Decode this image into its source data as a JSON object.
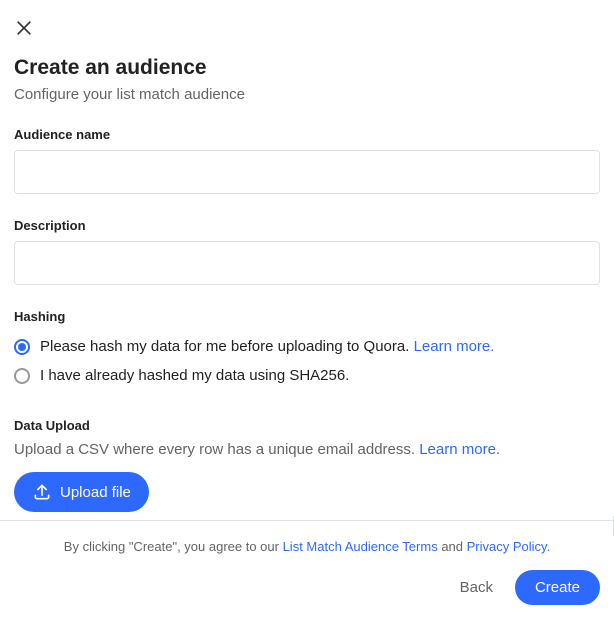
{
  "header": {
    "title": "Create an audience",
    "subtitle": "Configure your list match audience"
  },
  "fields": {
    "audienceName": {
      "label": "Audience name",
      "value": ""
    },
    "description": {
      "label": "Description",
      "value": ""
    }
  },
  "hashing": {
    "label": "Hashing",
    "options": [
      {
        "text": "Please hash my data for me before uploading to Quora. ",
        "link": "Learn more.",
        "selected": true
      },
      {
        "text": "I have already hashed my data using SHA256.",
        "link": "",
        "selected": false
      }
    ]
  },
  "upload": {
    "label": "Data Upload",
    "helper": "Upload a CSV where every row has a unique email address. ",
    "helperLink": "Learn more.",
    "buttonLabel": "Upload file"
  },
  "footer": {
    "termsPrefix": "By clicking \"Create\", you agree to our ",
    "termsLink1": "List Match Audience Terms",
    "termsMiddle": " and ",
    "termsLink2": "Privacy Policy",
    "termsEnd": ".",
    "backLabel": "Back",
    "createLabel": "Create"
  }
}
